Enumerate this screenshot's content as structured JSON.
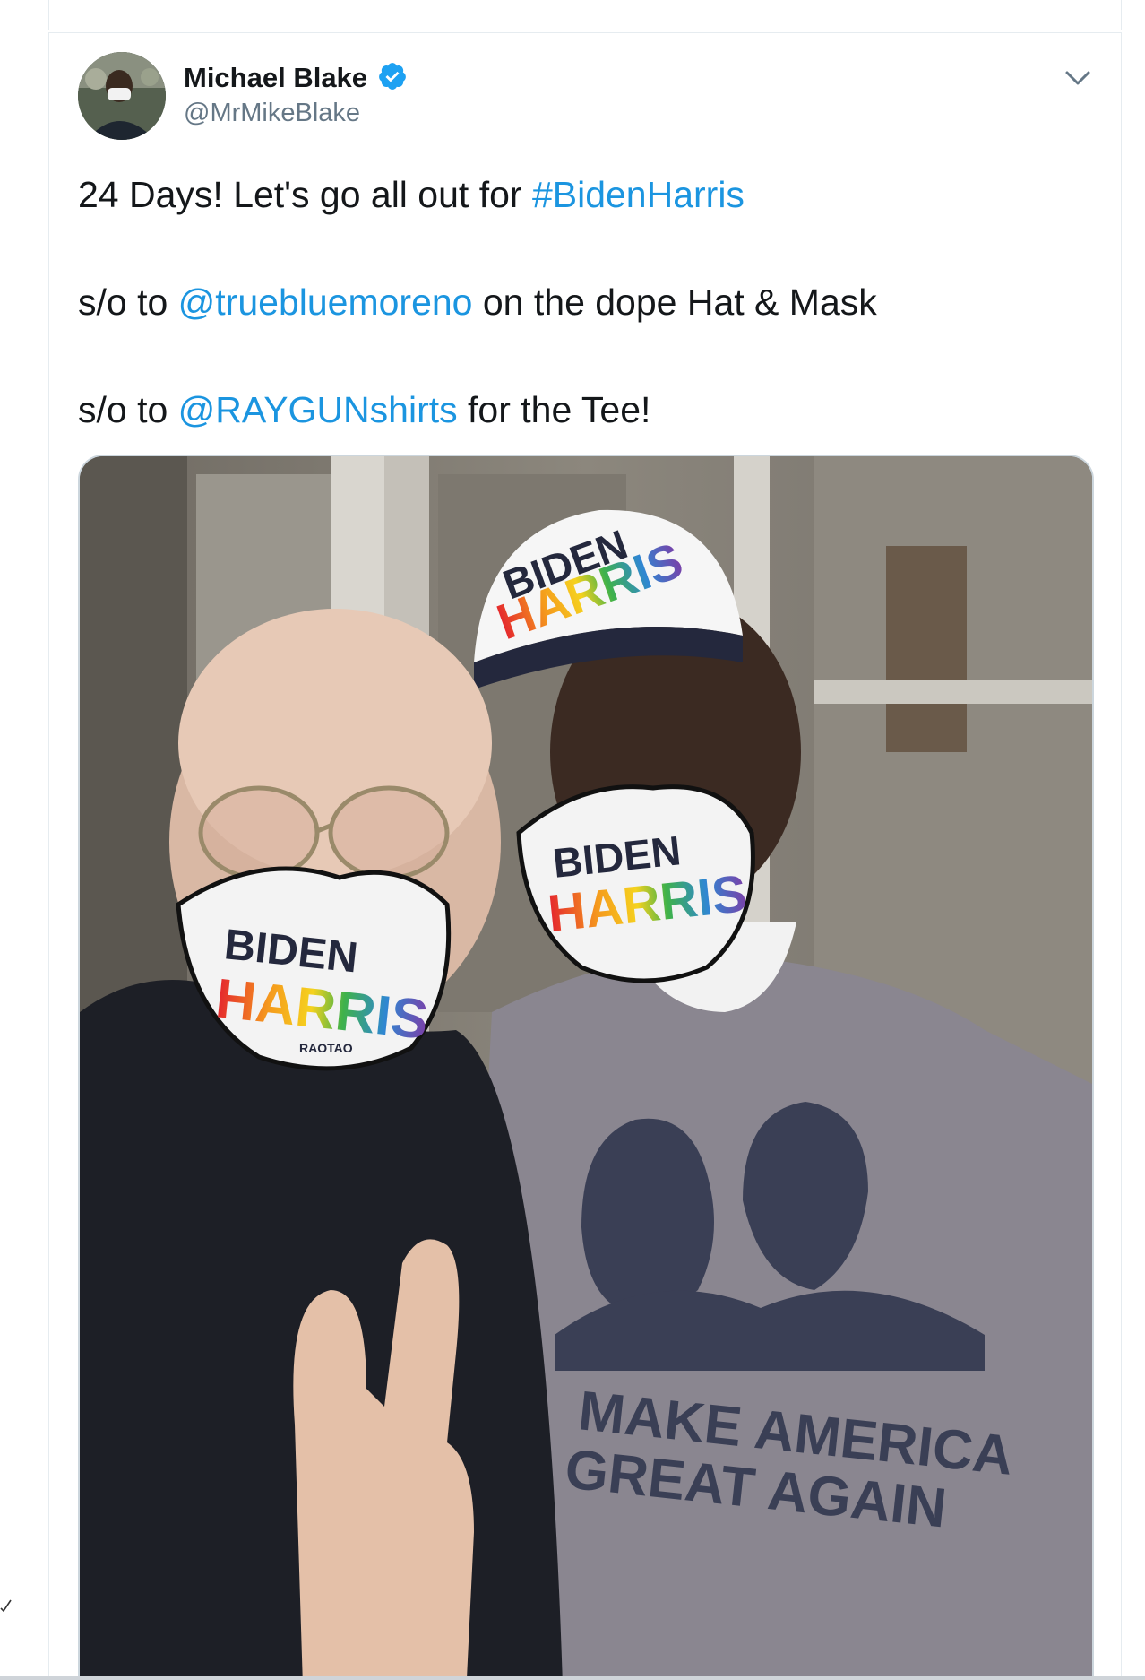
{
  "tweet": {
    "author": {
      "display_name": "Michael Blake",
      "handle": "@MrMikeBlake",
      "verified": true
    },
    "lines": [
      {
        "pre": "24 Days! Let's go all out for ",
        "link": "#BidenHarris",
        "post": ""
      },
      {
        "pre": "s/o to ",
        "link": "@truebluemoreno",
        "post": " on the dope Hat & Mask"
      },
      {
        "pre": "s/o to ",
        "link": "@RAYGUNshirts",
        "post": " for the Tee!"
      }
    ],
    "photo": {
      "mask_left_top": "BIDEN",
      "mask_left_bottom": "HARRIS",
      "mask_right_top": "BIDEN",
      "mask_right_bottom": "HARRIS",
      "hat_top": "BIDEN",
      "hat_bottom": "HARRIS",
      "shirt_line1": "MAKE AMERICA",
      "shirt_line2": "GREAT AGAIN",
      "tag": "RAOTAO"
    }
  },
  "colors": {
    "link": "#1b95e0",
    "text": "#14171a",
    "muted": "#657786",
    "verified": "#1da1f2"
  },
  "icons": {
    "verified": "verified-badge-icon",
    "menu": "chevron-down-icon"
  }
}
